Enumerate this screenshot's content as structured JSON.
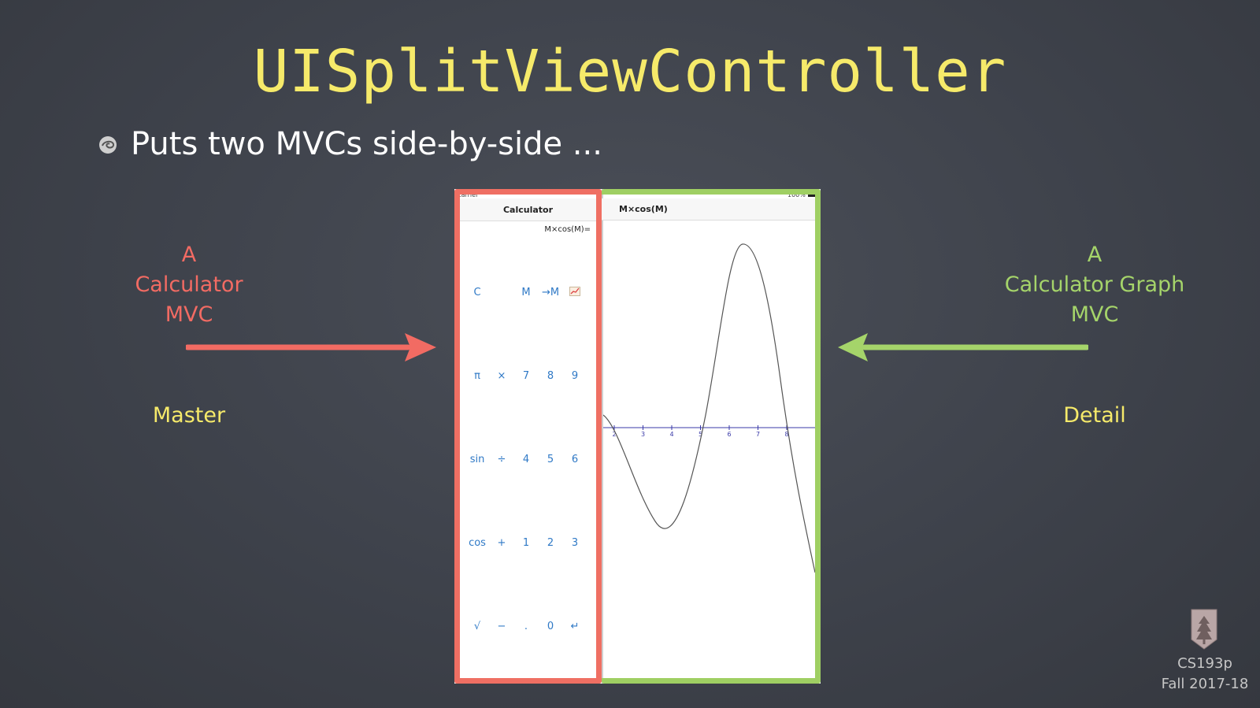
{
  "slide": {
    "title": "UISplitViewController",
    "bullet": "Puts two MVCs side-by-side ...",
    "left_label": [
      "A",
      "Calculator",
      "MVC"
    ],
    "right_label": [
      "A",
      "Calculator Graph",
      "MVC"
    ],
    "left_role": "Master",
    "right_role": "Detail",
    "footer_course": "CS193p",
    "footer_term": "Fall 2017-18"
  },
  "device": {
    "carrier": "Carrier",
    "battery": "100%",
    "master_title": "Calculator",
    "detail_title": "M×cos(M)",
    "display": "M×cos(M)=",
    "keys": [
      [
        "C",
        "",
        "M",
        "→M",
        "📈"
      ],
      [
        "π",
        "×",
        "7",
        "8",
        "9"
      ],
      [
        "sin",
        "÷",
        "4",
        "5",
        "6"
      ],
      [
        "cos",
        "+",
        "1",
        "2",
        "3"
      ],
      [
        "√",
        "−",
        ".",
        "0",
        "↵"
      ]
    ],
    "graph_ticks": [
      "2",
      "3",
      "4",
      "5",
      "6",
      "7",
      "8"
    ]
  },
  "colors": {
    "title": "#f6ea6a",
    "master": "#ef6f63",
    "detail": "#9fcf63",
    "key": "#2f79c6"
  },
  "icons": {
    "bullet": "swirl-bullet-icon",
    "logo": "stanford-tree-logo"
  }
}
